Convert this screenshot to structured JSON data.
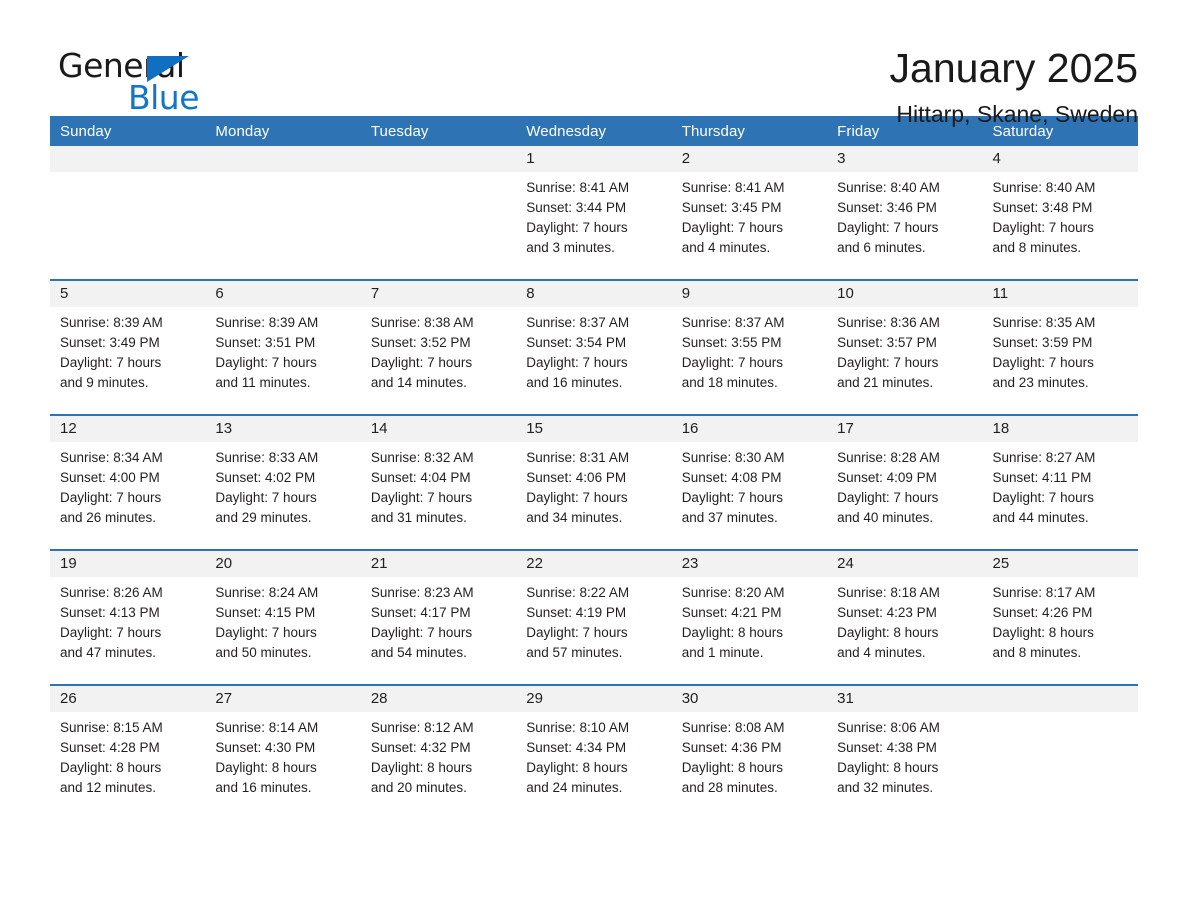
{
  "logo": {
    "word_one": "General",
    "word_two": "Blue",
    "triangle_color": "#0f6fc0",
    "blue_text_color": "#1276c4"
  },
  "header": {
    "title": "January 2025",
    "subtitle": "Hittarp, Skane, Sweden"
  },
  "theme": {
    "header_blue": "#2e74b5",
    "day_band_gray": "#f2f2f2",
    "text_color": "#231f20",
    "background": "#ffffff"
  },
  "weekdays": [
    "Sunday",
    "Monday",
    "Tuesday",
    "Wednesday",
    "Thursday",
    "Friday",
    "Saturday"
  ],
  "labels": {
    "sunrise_prefix": "Sunrise:",
    "sunset_prefix": "Sunset:",
    "daylight_prefix": "Daylight:"
  },
  "weeks": [
    [
      {
        "empty": true
      },
      {
        "empty": true
      },
      {
        "empty": true
      },
      {
        "day": "1",
        "sunrise": "Sunrise: 8:41 AM",
        "sunset": "Sunset: 3:44 PM",
        "daylight_line1": "Daylight: 7 hours",
        "daylight_line2": "and 3 minutes."
      },
      {
        "day": "2",
        "sunrise": "Sunrise: 8:41 AM",
        "sunset": "Sunset: 3:45 PM",
        "daylight_line1": "Daylight: 7 hours",
        "daylight_line2": "and 4 minutes."
      },
      {
        "day": "3",
        "sunrise": "Sunrise: 8:40 AM",
        "sunset": "Sunset: 3:46 PM",
        "daylight_line1": "Daylight: 7 hours",
        "daylight_line2": "and 6 minutes."
      },
      {
        "day": "4",
        "sunrise": "Sunrise: 8:40 AM",
        "sunset": "Sunset: 3:48 PM",
        "daylight_line1": "Daylight: 7 hours",
        "daylight_line2": "and 8 minutes."
      }
    ],
    [
      {
        "day": "5",
        "sunrise": "Sunrise: 8:39 AM",
        "sunset": "Sunset: 3:49 PM",
        "daylight_line1": "Daylight: 7 hours",
        "daylight_line2": "and 9 minutes."
      },
      {
        "day": "6",
        "sunrise": "Sunrise: 8:39 AM",
        "sunset": "Sunset: 3:51 PM",
        "daylight_line1": "Daylight: 7 hours",
        "daylight_line2": "and 11 minutes."
      },
      {
        "day": "7",
        "sunrise": "Sunrise: 8:38 AM",
        "sunset": "Sunset: 3:52 PM",
        "daylight_line1": "Daylight: 7 hours",
        "daylight_line2": "and 14 minutes."
      },
      {
        "day": "8",
        "sunrise": "Sunrise: 8:37 AM",
        "sunset": "Sunset: 3:54 PM",
        "daylight_line1": "Daylight: 7 hours",
        "daylight_line2": "and 16 minutes."
      },
      {
        "day": "9",
        "sunrise": "Sunrise: 8:37 AM",
        "sunset": "Sunset: 3:55 PM",
        "daylight_line1": "Daylight: 7 hours",
        "daylight_line2": "and 18 minutes."
      },
      {
        "day": "10",
        "sunrise": "Sunrise: 8:36 AM",
        "sunset": "Sunset: 3:57 PM",
        "daylight_line1": "Daylight: 7 hours",
        "daylight_line2": "and 21 minutes."
      },
      {
        "day": "11",
        "sunrise": "Sunrise: 8:35 AM",
        "sunset": "Sunset: 3:59 PM",
        "daylight_line1": "Daylight: 7 hours",
        "daylight_line2": "and 23 minutes."
      }
    ],
    [
      {
        "day": "12",
        "sunrise": "Sunrise: 8:34 AM",
        "sunset": "Sunset: 4:00 PM",
        "daylight_line1": "Daylight: 7 hours",
        "daylight_line2": "and 26 minutes."
      },
      {
        "day": "13",
        "sunrise": "Sunrise: 8:33 AM",
        "sunset": "Sunset: 4:02 PM",
        "daylight_line1": "Daylight: 7 hours",
        "daylight_line2": "and 29 minutes."
      },
      {
        "day": "14",
        "sunrise": "Sunrise: 8:32 AM",
        "sunset": "Sunset: 4:04 PM",
        "daylight_line1": "Daylight: 7 hours",
        "daylight_line2": "and 31 minutes."
      },
      {
        "day": "15",
        "sunrise": "Sunrise: 8:31 AM",
        "sunset": "Sunset: 4:06 PM",
        "daylight_line1": "Daylight: 7 hours",
        "daylight_line2": "and 34 minutes."
      },
      {
        "day": "16",
        "sunrise": "Sunrise: 8:30 AM",
        "sunset": "Sunset: 4:08 PM",
        "daylight_line1": "Daylight: 7 hours",
        "daylight_line2": "and 37 minutes."
      },
      {
        "day": "17",
        "sunrise": "Sunrise: 8:28 AM",
        "sunset": "Sunset: 4:09 PM",
        "daylight_line1": "Daylight: 7 hours",
        "daylight_line2": "and 40 minutes."
      },
      {
        "day": "18",
        "sunrise": "Sunrise: 8:27 AM",
        "sunset": "Sunset: 4:11 PM",
        "daylight_line1": "Daylight: 7 hours",
        "daylight_line2": "and 44 minutes."
      }
    ],
    [
      {
        "day": "19",
        "sunrise": "Sunrise: 8:26 AM",
        "sunset": "Sunset: 4:13 PM",
        "daylight_line1": "Daylight: 7 hours",
        "daylight_line2": "and 47 minutes."
      },
      {
        "day": "20",
        "sunrise": "Sunrise: 8:24 AM",
        "sunset": "Sunset: 4:15 PM",
        "daylight_line1": "Daylight: 7 hours",
        "daylight_line2": "and 50 minutes."
      },
      {
        "day": "21",
        "sunrise": "Sunrise: 8:23 AM",
        "sunset": "Sunset: 4:17 PM",
        "daylight_line1": "Daylight: 7 hours",
        "daylight_line2": "and 54 minutes."
      },
      {
        "day": "22",
        "sunrise": "Sunrise: 8:22 AM",
        "sunset": "Sunset: 4:19 PM",
        "daylight_line1": "Daylight: 7 hours",
        "daylight_line2": "and 57 minutes."
      },
      {
        "day": "23",
        "sunrise": "Sunrise: 8:20 AM",
        "sunset": "Sunset: 4:21 PM",
        "daylight_line1": "Daylight: 8 hours",
        "daylight_line2": "and 1 minute."
      },
      {
        "day": "24",
        "sunrise": "Sunrise: 8:18 AM",
        "sunset": "Sunset: 4:23 PM",
        "daylight_line1": "Daylight: 8 hours",
        "daylight_line2": "and 4 minutes."
      },
      {
        "day": "25",
        "sunrise": "Sunrise: 8:17 AM",
        "sunset": "Sunset: 4:26 PM",
        "daylight_line1": "Daylight: 8 hours",
        "daylight_line2": "and 8 minutes."
      }
    ],
    [
      {
        "day": "26",
        "sunrise": "Sunrise: 8:15 AM",
        "sunset": "Sunset: 4:28 PM",
        "daylight_line1": "Daylight: 8 hours",
        "daylight_line2": "and 12 minutes."
      },
      {
        "day": "27",
        "sunrise": "Sunrise: 8:14 AM",
        "sunset": "Sunset: 4:30 PM",
        "daylight_line1": "Daylight: 8 hours",
        "daylight_line2": "and 16 minutes."
      },
      {
        "day": "28",
        "sunrise": "Sunrise: 8:12 AM",
        "sunset": "Sunset: 4:32 PM",
        "daylight_line1": "Daylight: 8 hours",
        "daylight_line2": "and 20 minutes."
      },
      {
        "day": "29",
        "sunrise": "Sunrise: 8:10 AM",
        "sunset": "Sunset: 4:34 PM",
        "daylight_line1": "Daylight: 8 hours",
        "daylight_line2": "and 24 minutes."
      },
      {
        "day": "30",
        "sunrise": "Sunrise: 8:08 AM",
        "sunset": "Sunset: 4:36 PM",
        "daylight_line1": "Daylight: 8 hours",
        "daylight_line2": "and 28 minutes."
      },
      {
        "day": "31",
        "sunrise": "Sunrise: 8:06 AM",
        "sunset": "Sunset: 4:38 PM",
        "daylight_line1": "Daylight: 8 hours",
        "daylight_line2": "and 32 minutes."
      },
      {
        "empty": true
      }
    ]
  ]
}
